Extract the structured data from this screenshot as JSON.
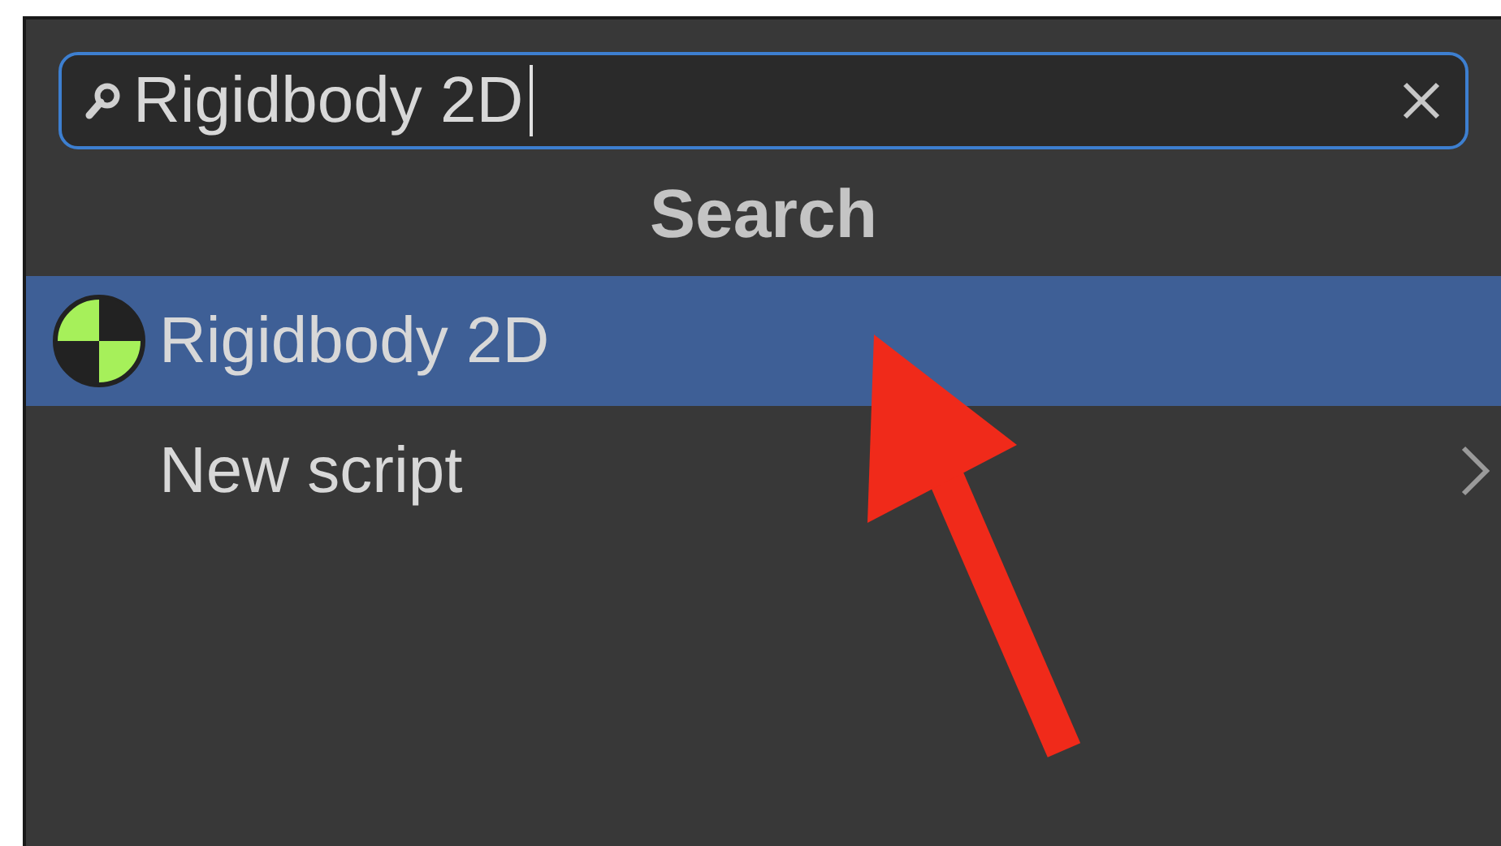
{
  "search": {
    "value": "Rigidbody 2D",
    "focused": true
  },
  "header": "Search",
  "items": [
    {
      "kind": "component",
      "label": "Rigidbody 2D",
      "selected": true
    },
    {
      "kind": "submenu",
      "label": "New script",
      "selected": false
    }
  ]
}
